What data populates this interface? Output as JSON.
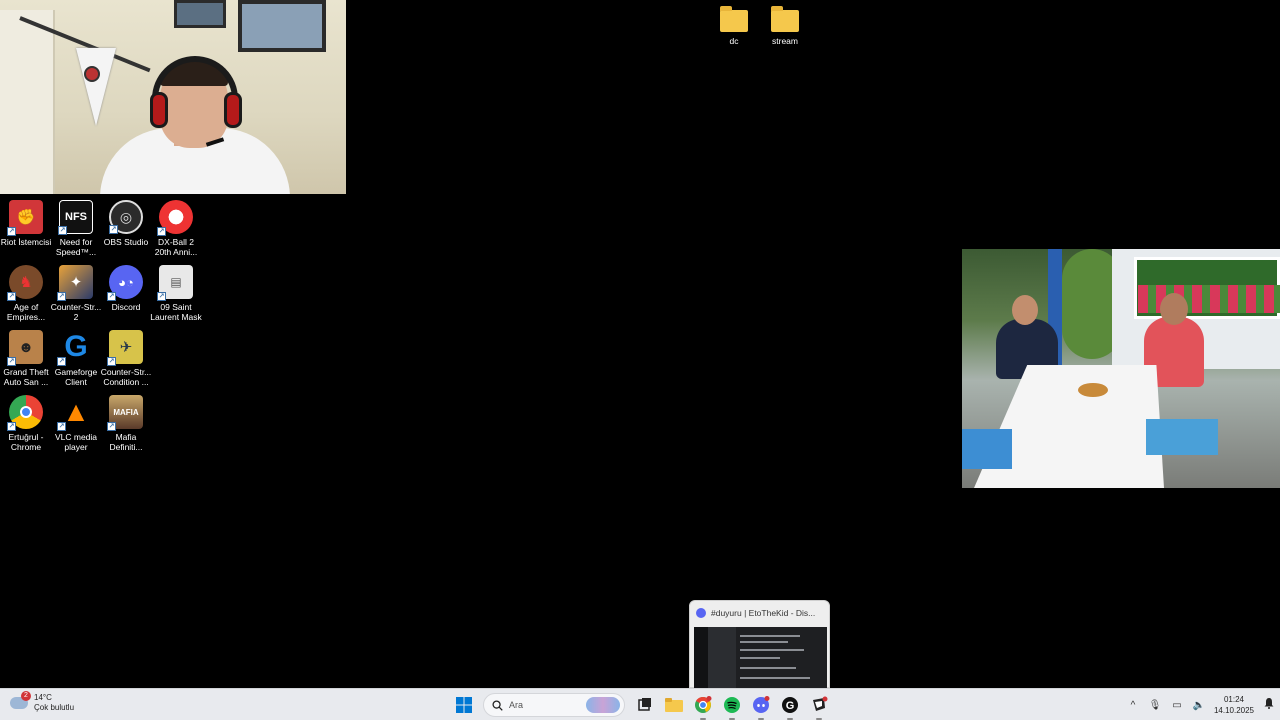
{
  "desktop": {
    "folders": [
      {
        "name": "dc"
      },
      {
        "name": "stream"
      }
    ],
    "icons": [
      {
        "label": "Riot İstemcisi",
        "icon": "riot-client-icon",
        "color": "#d13639"
      },
      {
        "label": "Need for Speed™...",
        "icon": "need-for-speed-icon",
        "color": "#ffffff"
      },
      {
        "label": "OBS Studio",
        "icon": "obs-studio-icon",
        "color": "#2b2b2b"
      },
      {
        "label": "DX-Ball 2 20th Anni...",
        "icon": "dx-ball-icon",
        "color": "#e33"
      },
      {
        "label": "Age of Empires...",
        "icon": "age-of-empires-icon",
        "color": "#7a4a2a"
      },
      {
        "label": "Counter-Str... 2",
        "icon": "counter-strike-2-icon",
        "color": "#e8a23a"
      },
      {
        "label": "Discord",
        "icon": "discord-icon",
        "color": "#5865f2"
      },
      {
        "label": "09 Saint Laurent Mask",
        "icon": "image-file-icon",
        "color": "#dddddd"
      },
      {
        "label": "Grand Theft Auto San ...",
        "icon": "gta-san-andreas-icon",
        "color": "#b9824a"
      },
      {
        "label": "Gameforge Client",
        "icon": "gameforge-icon",
        "color": "#1e88e5"
      },
      {
        "label": "Counter-Str... Condition ...",
        "icon": "counter-strike-cz-icon",
        "color": "#d7c34a"
      },
      {
        "label": "Ertuğrul - Chrome",
        "icon": "chrome-icon",
        "color": "#34a853"
      },
      {
        "label": "VLC media player",
        "icon": "vlc-icon",
        "color": "#ff8800"
      },
      {
        "label": "Mafia Definiti...",
        "icon": "mafia-icon",
        "color": "#7a5a3a"
      }
    ]
  },
  "preview": {
    "title": "#duyuru | EtoTheKid - Dis..."
  },
  "taskbar": {
    "weather_temp": "14°C",
    "weather_desc": "Çok bulutlu",
    "weather_badge": "2",
    "search_placeholder": "Ara",
    "time": "01:24",
    "date": "14.10.2025",
    "apps": [
      {
        "name": "start-button",
        "icon": "windows-logo-icon"
      },
      {
        "name": "task-view-button",
        "icon": "task-view-icon"
      },
      {
        "name": "file-explorer-button",
        "icon": "folder-icon"
      },
      {
        "name": "chrome-button",
        "icon": "chrome-icon"
      },
      {
        "name": "spotify-button",
        "icon": "spotify-icon"
      },
      {
        "name": "discord-button",
        "icon": "discord-icon"
      },
      {
        "name": "g-app-button",
        "icon": "g-app-icon"
      },
      {
        "name": "riot-button",
        "icon": "riot-icon"
      }
    ]
  }
}
